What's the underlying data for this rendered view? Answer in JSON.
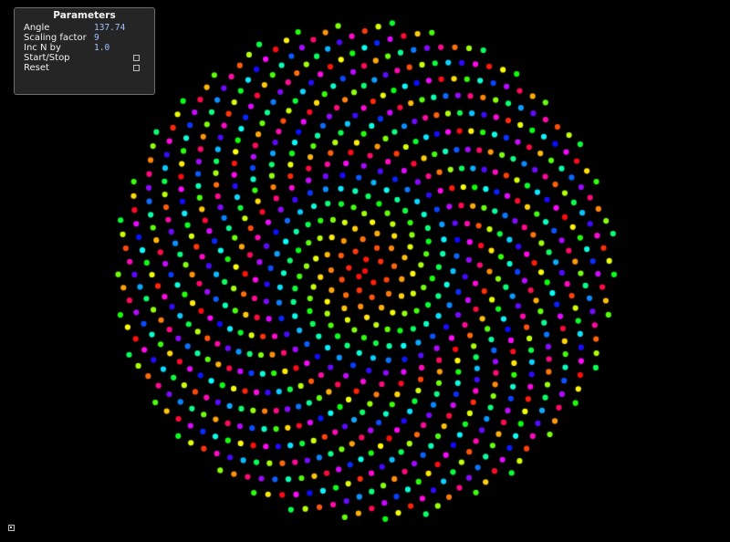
{
  "panel": {
    "title": "Parameters",
    "params": [
      {
        "label": "Angle",
        "value": "137.74"
      },
      {
        "label": "Scaling factor",
        "value": "9"
      },
      {
        "label": "Inc N by",
        "value": "1.0"
      }
    ],
    "toggles": [
      {
        "label": "Start/Stop"
      },
      {
        "label": "Reset"
      }
    ]
  },
  "corner_icon": {
    "icon": "gui-toggle-icon"
  },
  "visualization": {
    "type": "phyllotaxis",
    "angle_degrees": 137.74,
    "scaling_factor": 9,
    "inc_n_by": 1.0,
    "background": "#000000",
    "palette": "rainbow-hsl"
  }
}
